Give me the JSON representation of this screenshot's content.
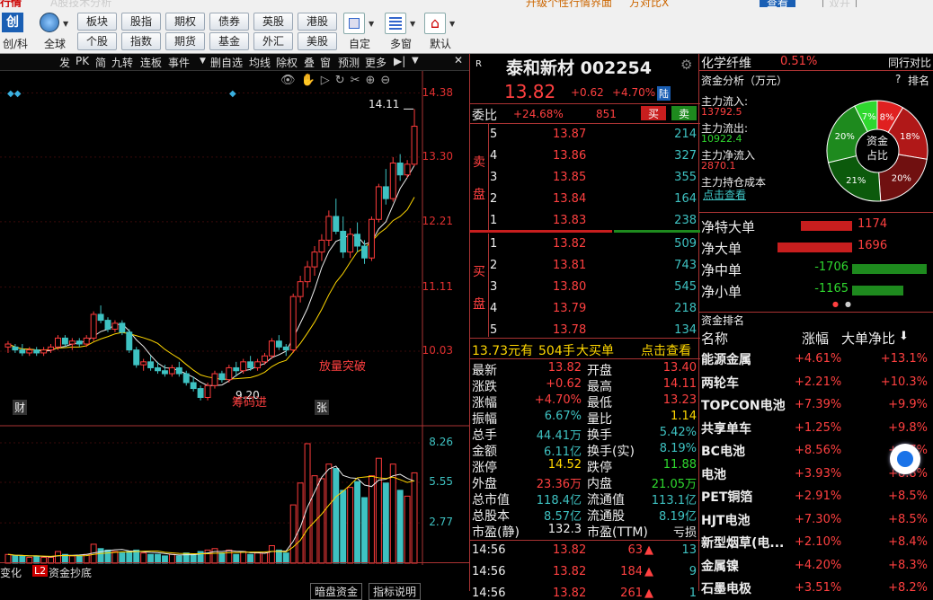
{
  "titlebar": {
    "left": "行情",
    "mid": "A股技术分析",
    "right1": "升级个性行情界面",
    "right2": "方对比X",
    "btn1": "查看",
    "btn2": "双开"
  },
  "toolbar": {
    "left_icon_label": "创/科",
    "globe_label": "全球",
    "row1": [
      "板块",
      "股指",
      "期权",
      "债券",
      "英股",
      "港股"
    ],
    "row2": [
      "个股",
      "指数",
      "期货",
      "基金",
      "外汇",
      "美股"
    ],
    "custom_label": "自定",
    "multi_label": "多窗",
    "default_label": "默认"
  },
  "chart_toolbar": [
    "发",
    "PK",
    "简",
    "九转",
    "连板",
    "事件",
    "删自选",
    "均线",
    "除权",
    "叠",
    "窗",
    "预测",
    "更多"
  ],
  "chart": {
    "price_ticks": [
      "14.38",
      "13.30",
      "12.21",
      "11.11",
      "10.03"
    ],
    "vol_ticks": [
      "8.26",
      "5.55",
      "2.77"
    ],
    "high_label": "14.11",
    "low_label": "9.20",
    "annot_breakout": "放量突破",
    "annot_inflow": "筹码进",
    "marker_cai": "财",
    "marker_zhang": "张",
    "candles": [
      [
        10.1,
        10.2,
        10.0,
        10.15
      ],
      [
        10.1,
        10.15,
        10.0,
        10.05
      ],
      [
        10.05,
        10.15,
        9.95,
        10.0
      ],
      [
        10.0,
        10.1,
        9.95,
        10.05
      ],
      [
        10.05,
        10.1,
        9.95,
        10.0
      ],
      [
        10.0,
        10.1,
        9.95,
        10.05
      ],
      [
        10.05,
        10.15,
        10.0,
        10.1
      ],
      [
        10.1,
        10.3,
        10.05,
        10.25
      ],
      [
        10.25,
        10.3,
        10.1,
        10.15
      ],
      [
        10.15,
        10.25,
        10.05,
        10.2
      ],
      [
        10.2,
        10.25,
        10.1,
        10.15
      ],
      [
        10.15,
        10.3,
        10.1,
        10.25
      ],
      [
        10.25,
        10.7,
        10.2,
        10.65
      ],
      [
        10.65,
        10.8,
        10.5,
        10.55
      ],
      [
        10.55,
        10.6,
        10.35,
        10.4
      ],
      [
        10.4,
        10.55,
        10.35,
        10.5
      ],
      [
        10.5,
        10.55,
        10.3,
        10.35
      ],
      [
        10.35,
        10.4,
        10.0,
        10.05
      ],
      [
        10.05,
        10.1,
        9.75,
        9.8
      ],
      [
        9.8,
        9.9,
        9.7,
        9.85
      ],
      [
        9.85,
        9.95,
        9.7,
        9.75
      ],
      [
        9.75,
        9.85,
        9.65,
        9.7
      ],
      [
        9.7,
        9.8,
        9.6,
        9.65
      ],
      [
        9.65,
        9.8,
        9.6,
        9.75
      ],
      [
        9.75,
        9.85,
        9.6,
        9.65
      ],
      [
        9.65,
        9.7,
        9.45,
        9.5
      ],
      [
        9.5,
        9.6,
        9.35,
        9.4
      ],
      [
        9.4,
        9.45,
        9.2,
        9.25
      ],
      [
        9.25,
        9.5,
        9.2,
        9.45
      ],
      [
        9.45,
        9.7,
        9.4,
        9.65
      ],
      [
        9.65,
        9.7,
        9.5,
        9.55
      ],
      [
        9.55,
        9.8,
        9.5,
        9.75
      ],
      [
        9.75,
        9.85,
        9.6,
        9.7
      ],
      [
        9.7,
        9.9,
        9.65,
        9.85
      ],
      [
        9.85,
        9.95,
        9.7,
        9.75
      ],
      [
        9.75,
        9.9,
        9.7,
        9.85
      ],
      [
        9.85,
        10.0,
        9.8,
        9.95
      ],
      [
        9.95,
        10.25,
        9.9,
        10.2
      ],
      [
        10.2,
        10.3,
        10.05,
        10.1
      ],
      [
        10.1,
        10.15,
        9.95,
        10.05
      ],
      [
        10.05,
        11.0,
        10.0,
        10.95
      ],
      [
        10.95,
        11.3,
        10.85,
        11.2
      ],
      [
        11.2,
        11.55,
        11.1,
        11.45
      ],
      [
        11.45,
        11.8,
        11.3,
        11.7
      ],
      [
        11.7,
        12.0,
        11.55,
        11.9
      ],
      [
        11.9,
        12.4,
        11.8,
        12.3
      ],
      [
        12.3,
        12.6,
        12.0,
        12.05
      ],
      [
        12.05,
        12.3,
        11.6,
        11.7
      ],
      [
        11.7,
        12.1,
        11.6,
        12.0
      ],
      [
        12.0,
        12.2,
        11.7,
        11.8
      ],
      [
        11.8,
        11.9,
        11.5,
        11.6
      ],
      [
        11.6,
        12.3,
        11.55,
        12.25
      ],
      [
        12.25,
        12.85,
        12.2,
        12.8
      ],
      [
        12.8,
        13.1,
        12.5,
        12.6
      ],
      [
        12.6,
        13.3,
        12.55,
        13.2
      ],
      [
        13.2,
        13.35,
        12.9,
        13.0
      ],
      [
        13.0,
        13.25,
        12.95,
        13.18
      ],
      [
        13.18,
        14.11,
        13.15,
        13.82
      ]
    ],
    "volumes": [
      0.6,
      0.5,
      0.5,
      0.4,
      0.5,
      0.4,
      0.4,
      0.8,
      0.6,
      0.5,
      0.5,
      0.6,
      1.3,
      1.0,
      0.9,
      0.8,
      0.7,
      0.8,
      0.9,
      0.7,
      0.6,
      0.6,
      0.5,
      0.6,
      0.5,
      0.7,
      0.6,
      0.8,
      0.9,
      1.0,
      0.7,
      0.9,
      0.6,
      0.8,
      0.6,
      0.7,
      0.7,
      1.2,
      0.9,
      0.7,
      4.0,
      5.5,
      8.2,
      6.0,
      5.8,
      6.8,
      6.5,
      5.0,
      5.2,
      5.6,
      4.5,
      6.0,
      7.2,
      5.5,
      6.8,
      5.0,
      4.6,
      6.2
    ]
  },
  "bottom_tabs": {
    "tab1": "变化",
    "l2": "L2",
    "tab2": "资金抄底",
    "tab3": "暗盘资金",
    "tab4": "指标说明"
  },
  "quote": {
    "badge": "R",
    "name": "泰和新材 002254",
    "price": "13.82",
    "change": "+0.62",
    "pct": "+4.70%",
    "tag": "陆",
    "webi_label": "委比",
    "webi_value": "+24.68%",
    "webi_num": "851",
    "buy_btn": "买",
    "sell_btn": "卖",
    "sell_label": [
      "卖",
      "盘"
    ],
    "buy_label": [
      "买",
      "盘"
    ],
    "asks": [
      {
        "lv": "5",
        "p": "13.87",
        "v": "214"
      },
      {
        "lv": "4",
        "p": "13.86",
        "v": "327"
      },
      {
        "lv": "3",
        "p": "13.85",
        "v": "355"
      },
      {
        "lv": "2",
        "p": "13.84",
        "v": "164"
      },
      {
        "lv": "1",
        "p": "13.83",
        "v": "238"
      }
    ],
    "bids": [
      {
        "lv": "1",
        "p": "13.82",
        "v": "509"
      },
      {
        "lv": "2",
        "p": "13.81",
        "v": "743"
      },
      {
        "lv": "3",
        "p": "13.80",
        "v": "545"
      },
      {
        "lv": "4",
        "p": "13.79",
        "v": "218"
      },
      {
        "lv": "5",
        "p": "13.78",
        "v": "134"
      }
    ],
    "bigorder": {
      "price": "13.73元有",
      "vol": "504手",
      "type": "大买单",
      "link": "点击查看"
    },
    "stats_left": [
      [
        "最新",
        "13.82"
      ],
      [
        "涨跌",
        "+0.62"
      ],
      [
        "涨幅",
        "+4.70%"
      ],
      [
        "振幅",
        "6.67%"
      ],
      [
        "总手",
        "44.41万"
      ],
      [
        "金额",
        "6.11亿"
      ],
      [
        "涨停",
        "14.52"
      ],
      [
        "外盘",
        "23.36万"
      ],
      [
        "总市值",
        "118.4亿"
      ],
      [
        "总股本",
        "8.57亿"
      ],
      [
        "市盈(静)",
        "132.3"
      ]
    ],
    "stats_right": [
      [
        "开盘",
        "13.40"
      ],
      [
        "最高",
        "14.11"
      ],
      [
        "最低",
        "13.23"
      ],
      [
        "量比",
        "1.14"
      ],
      [
        "换手",
        "5.42%"
      ],
      [
        "换手(实)",
        "8.19%"
      ],
      [
        "跌停",
        "11.88"
      ],
      [
        "内盘",
        "21.05万"
      ],
      [
        "流通值",
        "113.1亿"
      ],
      [
        "流通股",
        "8.19亿"
      ],
      [
        "市盈(TTM)",
        "亏损"
      ]
    ],
    "ticks": [
      {
        "time": "14:56",
        "price": "13.82",
        "vol": "63",
        "n": "13"
      },
      {
        "time": "14:56",
        "price": "13.82",
        "vol": "184",
        "n": "9"
      },
      {
        "time": "14:56",
        "price": "13.82",
        "vol": "261",
        "n": "1"
      }
    ]
  },
  "sector": {
    "name": "化学纤维",
    "pct": "0.51%",
    "compare": "同行对比"
  },
  "fund": {
    "title": "资金分析（万元）",
    "help": "?",
    "rank": "排名",
    "rows": [
      [
        "主力流入:",
        "13792.5"
      ],
      [
        "主力流出:",
        "10922.4"
      ],
      [
        "主力净流入",
        "2870.1"
      ],
      [
        "主力持仓成本",
        ""
      ]
    ],
    "link": "点击查看",
    "donut_center": "资金\n占比",
    "slices": [
      {
        "pct": "8%",
        "v": 8,
        "color": "#e02020"
      },
      {
        "pct": "18%",
        "v": 18,
        "color": "#b01818"
      },
      {
        "pct": "20%",
        "v": 20,
        "color": "#701010"
      },
      {
        "pct": "21%",
        "v": 21,
        "color": "#0c5a0c"
      },
      {
        "pct": "20%",
        "v": 20,
        "color": "#1e8a1e"
      },
      {
        "pct": "7%",
        "v": 7,
        "color": "#2fd82f"
      }
    ]
  },
  "netflow": [
    {
      "label": "净特大单",
      "value": "1174"
    },
    {
      "label": "净大单",
      "value": "1696"
    },
    {
      "label": "净中单",
      "value": "-1706"
    },
    {
      "label": "净小单",
      "value": "-1165"
    }
  ],
  "ranking": {
    "title": "资金排名",
    "col_name": "名称",
    "col_pct": "涨幅",
    "col_net": "大单净比",
    "rows": [
      [
        "能源金属",
        "+4.61%",
        "+13.1%"
      ],
      [
        "两轮车",
        "+2.21%",
        "+10.3%"
      ],
      [
        "TOPCON电池",
        "+7.39%",
        "+9.9%"
      ],
      [
        "共享单车",
        "+1.25%",
        "+9.8%"
      ],
      [
        "BC电池",
        "+8.56%",
        "+9.7%"
      ],
      [
        "电池",
        "+3.93%",
        "+8.8%"
      ],
      [
        "PET铜箔",
        "+2.91%",
        "+8.5%"
      ],
      [
        "HJT电池",
        "+7.30%",
        "+8.5%"
      ],
      [
        "新型烟草(电...",
        "+2.10%",
        "+8.4%"
      ],
      [
        "金属镍",
        "+4.20%",
        "+8.3%"
      ],
      [
        "石墨电极",
        "+3.51%",
        "+8.2%"
      ]
    ]
  }
}
